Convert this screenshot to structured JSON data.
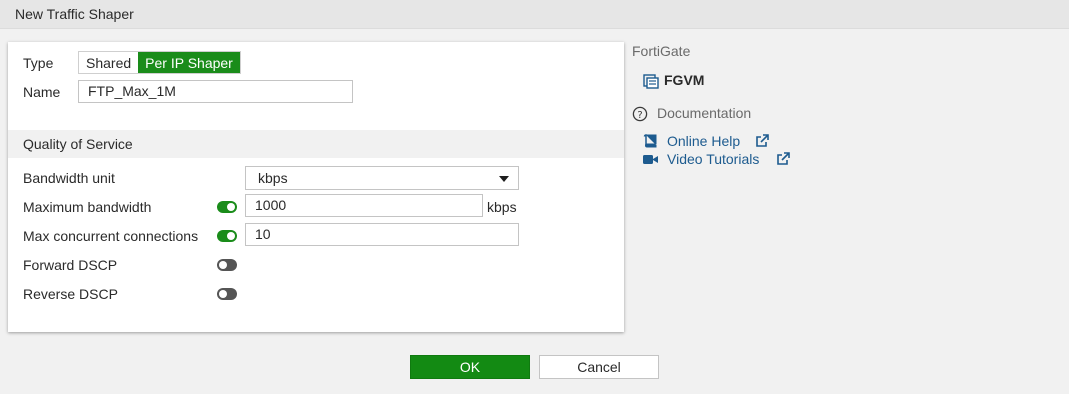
{
  "window": {
    "title": "New Traffic Shaper"
  },
  "form": {
    "type_label": "Type",
    "type_options": [
      "Shared",
      "Per IP Shaper"
    ],
    "type_selected": "Per IP Shaper",
    "name_label": "Name",
    "name_value": "FTP_Max_1M",
    "qos_header": "Quality of Service",
    "bandwidth_unit_label": "Bandwidth unit",
    "bandwidth_unit_value": "kbps",
    "max_bandwidth_label": "Maximum bandwidth",
    "max_bandwidth_enabled": true,
    "max_bandwidth_value": "1000",
    "max_bandwidth_unit": "kbps",
    "max_conn_label": "Max concurrent connections",
    "max_conn_enabled": true,
    "max_conn_value": "10",
    "forward_dscp_label": "Forward DSCP",
    "forward_dscp_enabled": false,
    "reverse_dscp_label": "Reverse DSCP",
    "reverse_dscp_enabled": false
  },
  "sidebar": {
    "device_header": "FortiGate",
    "device_name": "FGVM",
    "device_icon": "device-icon",
    "docs_header": "Documentation",
    "docs_icon": "question-circle-icon",
    "links": [
      {
        "label": "Online Help",
        "icon": "book-icon"
      },
      {
        "label": "Video Tutorials",
        "icon": "video-camera-icon"
      }
    ]
  },
  "buttons": {
    "ok": "OK",
    "cancel": "Cancel"
  },
  "colors": {
    "accent_green": "#1a8c1a",
    "link_blue": "#1d5b8f",
    "toggle_off": "#555555"
  }
}
